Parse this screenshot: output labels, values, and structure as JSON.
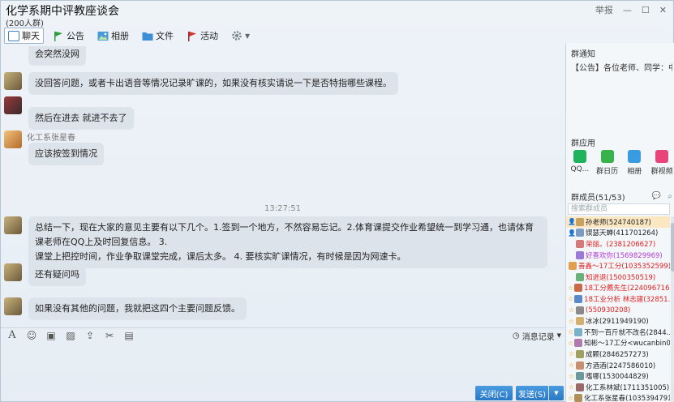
{
  "window": {
    "title": "化学系期中评教座谈会",
    "subtitle": "(200人群)",
    "report_label": "举报",
    "min_symbol": "—",
    "max_symbol": "☐",
    "close_symbol": "✕"
  },
  "toolbar": {
    "items": [
      {
        "label": "聊天",
        "icon": "chat-icon",
        "color": "#3f7fc2"
      },
      {
        "label": "公告",
        "icon": "flag-icon",
        "color": "#2e9e3a"
      },
      {
        "label": "相册",
        "icon": "photo-icon",
        "color": "#4a9ad8"
      },
      {
        "label": "文件",
        "icon": "folder-icon",
        "color": "#3c8fd6"
      },
      {
        "label": "活动",
        "icon": "activity-flag-icon",
        "color": "#d8332f"
      }
    ],
    "settings_icon": "gear-icon"
  },
  "chat": {
    "messages": [
      {
        "text": "会突然没网"
      },
      {
        "text": "没回答问题，或者卡出语音等情况记录旷课的，如果没有核实请说一下是否特指哪些课程。"
      },
      {
        "text": "然后在进去  就进不去了"
      },
      {
        "sender": "化工系张星春",
        "text": "应该按签到情况"
      },
      {
        "text": "总结一下，现在大家的意见主要有以下几个。1.签到一个地方，不然容易忘记。2.体育课提交作业希望统一到学习通，也请体育课老师在QQ上及时回复信息。 3.",
        "line2": "课堂上把控时间，作业争取课堂完成，课后太多。 4. 要核实旷课情况，有时候是因为网速卡。"
      },
      {
        "text": "还有疑问吗"
      },
      {
        "text": "如果没有其他的问题，我就把这四个主要问题反馈。"
      }
    ],
    "timestamp": "13:27:51"
  },
  "input": {
    "tools": [
      "font-icon",
      "emoji-icon",
      "screenshot-icon",
      "image-icon",
      "upload-icon",
      "scissors-icon",
      "more-icon"
    ],
    "history_label": "消息记录",
    "close_button": "关闭(C)",
    "send_button": "发送(S)"
  },
  "sidebar": {
    "notice_title": "群通知",
    "notice_text": "【公告】各位老师、同学：中午1...",
    "apps_title": "群应用",
    "apps": [
      {
        "label": "QQ...",
        "color": "#1fb45b"
      },
      {
        "label": "群日历",
        "color": "#38b24a"
      },
      {
        "label": "相册",
        "color": "#3b9be0"
      },
      {
        "label": "群视频",
        "color": "#e8457a"
      }
    ],
    "members_title": "群成员(51/53)",
    "member_search_placeholder": "搜索群成员",
    "members": [
      {
        "name": "孙老师(524740187)",
        "color": "#222",
        "star": "owner"
      },
      {
        "name": "锲瑟天蝉(411701264)",
        "color": "#222",
        "star": "admin"
      },
      {
        "name": "荣丽。(2381206627)",
        "color": "#e02020",
        "star": ""
      },
      {
        "name": "好喜欢你(1569829969)",
        "color": "#b23bd6",
        "star": ""
      },
      {
        "name": "善鑫～17工分(1035352599)",
        "color": "#e02020",
        "star": ""
      },
      {
        "name": "知进退(1500350519)",
        "color": "#e02020",
        "star": ""
      },
      {
        "name": "18工分薦先生(2240967168)",
        "color": "#e02020",
        "star": "star"
      },
      {
        "name": "18工业分析 林志建(32851...",
        "color": "#e02020",
        "star": "star"
      },
      {
        "name": "(550930208)",
        "color": "#e02020",
        "star": "star"
      },
      {
        "name": "冰冰(2911949190)",
        "color": "#222",
        "star": "star"
      },
      {
        "name": "不到一百斤就不改名(2844...",
        "color": "#222",
        "star": "star"
      },
      {
        "name": "知彬～17工分<wucanbin0...",
        "color": "#222",
        "star": "star"
      },
      {
        "name": "成颗(2846257273)",
        "color": "#222",
        "star": "star"
      },
      {
        "name": "方酒酒(2247586010)",
        "color": "#222",
        "star": "star"
      },
      {
        "name": "嗜哪(1530044829)",
        "color": "#222",
        "star": "star"
      },
      {
        "name": "化工系林斌(1711351005)",
        "color": "#222",
        "star": "star"
      },
      {
        "name": "化工系张星春(1035394791)",
        "color": "#222",
        "star": "star"
      }
    ]
  }
}
